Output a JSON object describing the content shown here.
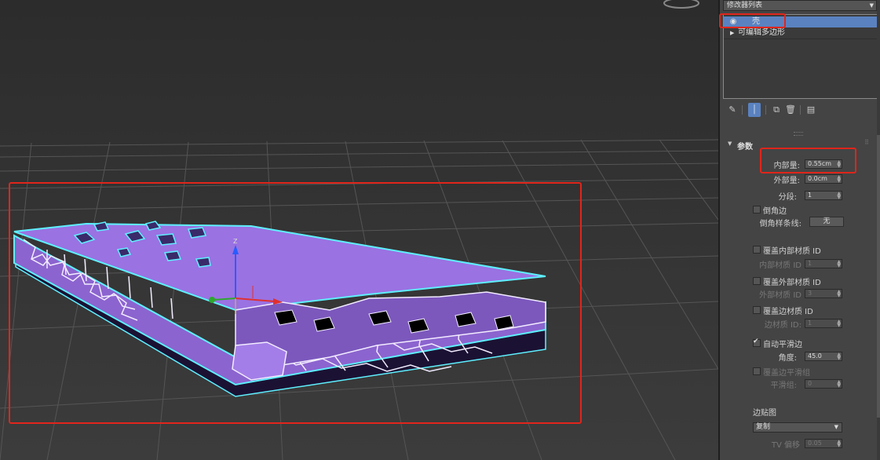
{
  "panel": {
    "modifier_list": "修改器列表",
    "stack": [
      {
        "label": "壳",
        "selected": true
      },
      {
        "label": "可编辑多边形",
        "selected": false
      }
    ],
    "rollout_title": "参数",
    "inner_amount": {
      "label": "内部量:",
      "value": "0.55cm"
    },
    "outer_amount": {
      "label": "外部量:",
      "value": "0.0cm"
    },
    "segments": {
      "label": "分段:",
      "value": "1"
    },
    "bevel_edges": {
      "label": "倒角边"
    },
    "bevel_spline": {
      "label": "倒角样条线:",
      "button": "无"
    },
    "override_inner_mat": {
      "label": "覆盖内部材质 ID"
    },
    "inner_mat_id": {
      "label": "内部材质 ID",
      "value": "1"
    },
    "override_outer_mat": {
      "label": "覆盖外部材质 ID"
    },
    "outer_mat_id": {
      "label": "外部材质 ID",
      "value": "3"
    },
    "override_edge_mat": {
      "label": "覆盖边材质 ID"
    },
    "edge_mat_id": {
      "label": "边材质 ID:",
      "value": "1"
    },
    "auto_smooth": {
      "label": "自动平滑边",
      "checked": true
    },
    "angle": {
      "label": "角度:",
      "value": "45.0"
    },
    "override_edge_smooth": {
      "label": "覆盖边平滑组"
    },
    "smooth_group": {
      "label": "平滑组:",
      "value": "0"
    },
    "edge_mapping": {
      "label": "边贴图",
      "value": "复制"
    },
    "tv_offset": {
      "label": "TV 偏移",
      "value": "0.05"
    }
  },
  "viewport": {
    "gizmo_axis": "Z"
  },
  "colors": {
    "highlight": "#e0251b",
    "selection": "#5a82c0",
    "mesh_fill": "#9b6fe0",
    "mesh_edge": "#5ef0ff"
  }
}
